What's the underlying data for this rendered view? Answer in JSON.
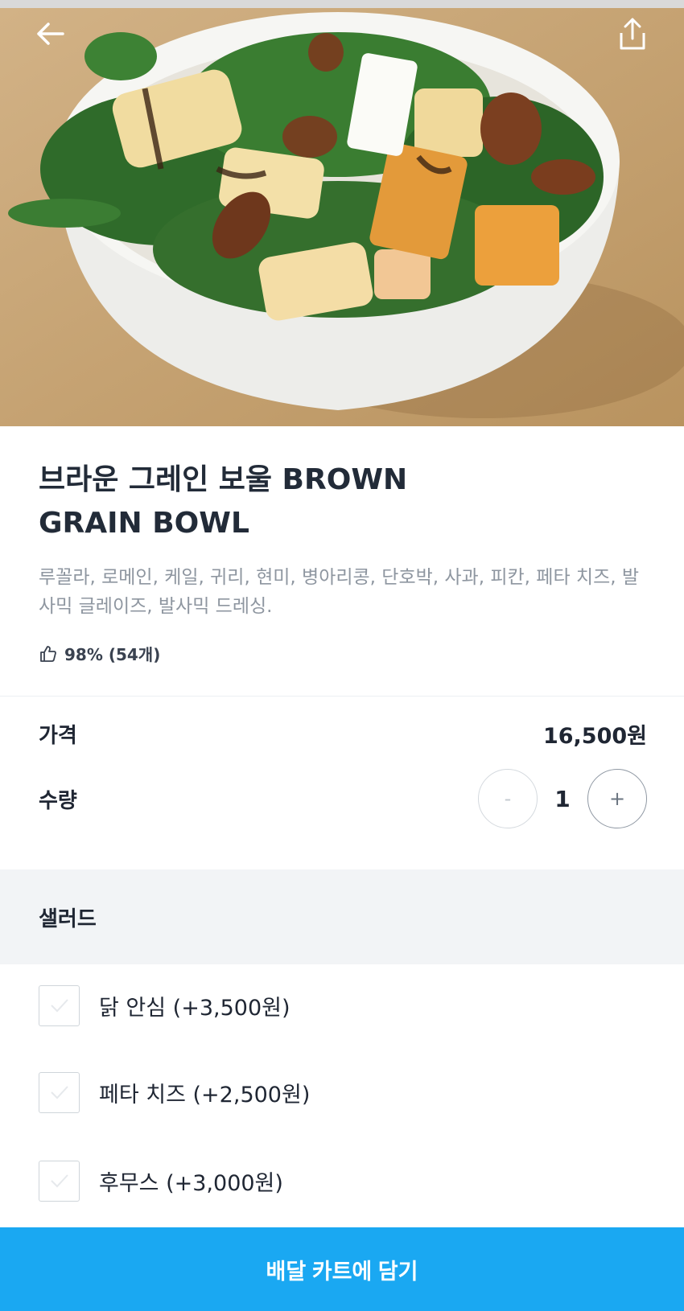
{
  "colors": {
    "accent": "#1aa8f2",
    "title": "#222b38",
    "muted_text": "#8e96a0",
    "section_bg": "#f2f4f6"
  },
  "header": {
    "back_icon": "arrow-left-icon",
    "share_icon": "share-icon"
  },
  "hero": {
    "image": "salad bowl photo"
  },
  "product": {
    "title": "브라운 그레인 보울 BROWN GRAIN BOWL",
    "description": "루꼴라, 로메인, 케일, 귀리, 현미, 병아리콩, 단호박, 사과, 피칸, 페타 치즈, 발사믹 글레이즈, 발사믹 드레싱.",
    "rating_icon": "thumbs-up-icon",
    "rating_text": "98% (54개)"
  },
  "price": {
    "label": "가격",
    "value": "16,500원"
  },
  "quantity": {
    "label": "수량",
    "minus_label": "-",
    "value": "1",
    "plus_label": "+"
  },
  "options_section": {
    "title": "샐러드",
    "items": [
      {
        "label": "닭 안심 (+3,500원)",
        "checked": false
      },
      {
        "label": "페타 치즈 (+2,500원)",
        "checked": false
      },
      {
        "label": "후무스 (+3,000원)",
        "checked": false
      }
    ]
  },
  "cart_button": {
    "label": "배달 카트에 담기"
  }
}
